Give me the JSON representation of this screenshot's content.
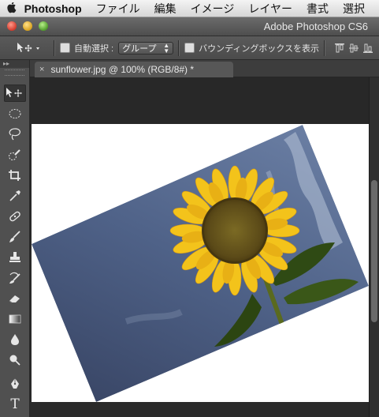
{
  "menubar": {
    "app_name": "Photoshop",
    "items": [
      "ファイル",
      "編集",
      "イメージ",
      "レイヤー",
      "書式",
      "選択"
    ]
  },
  "window": {
    "title": "Adobe Photoshop CS6"
  },
  "options_bar": {
    "auto_select_label": "自動選択 :",
    "auto_select_checked": false,
    "auto_select_target": "グループ",
    "bounding_box_label": "バウンディングボックスを表示",
    "bounding_box_checked": false
  },
  "tool_panel": {
    "collapse_glyph": "▸▸",
    "tools": [
      {
        "name": "move-tool",
        "glyph": "move"
      },
      {
        "name": "elliptical-marquee-tool",
        "glyph": "ellipse"
      },
      {
        "name": "lasso-tool",
        "glyph": "lasso"
      },
      {
        "name": "quick-selection-tool",
        "glyph": "quick"
      },
      {
        "name": "crop-tool",
        "glyph": "crop"
      },
      {
        "name": "eyedropper-tool",
        "glyph": "eyedropper"
      },
      {
        "name": "spot-healing-brush-tool",
        "glyph": "bandage"
      },
      {
        "name": "brush-tool",
        "glyph": "brush"
      },
      {
        "name": "clone-stamp-tool",
        "glyph": "stamp"
      },
      {
        "name": "history-brush-tool",
        "glyph": "history"
      },
      {
        "name": "eraser-tool",
        "glyph": "eraser"
      },
      {
        "name": "gradient-tool",
        "glyph": "gradient"
      },
      {
        "name": "blur-tool",
        "glyph": "drop"
      },
      {
        "name": "dodge-tool",
        "glyph": "dodge"
      },
      {
        "name": "pen-tool",
        "glyph": "pen"
      },
      {
        "name": "type-tool",
        "glyph": "T"
      }
    ],
    "active_tool": "move-tool"
  },
  "document_tab": {
    "close_glyph": "×",
    "label": "sunflower.jpg @ 100% (RGB/8#) *"
  },
  "colors": {
    "sky_top": "#5a6e94",
    "sky_bottom": "#3f4d6e",
    "petal": "#f2c21b",
    "flower_center": "#6b5a1e",
    "leaf": "#2e4a12"
  }
}
